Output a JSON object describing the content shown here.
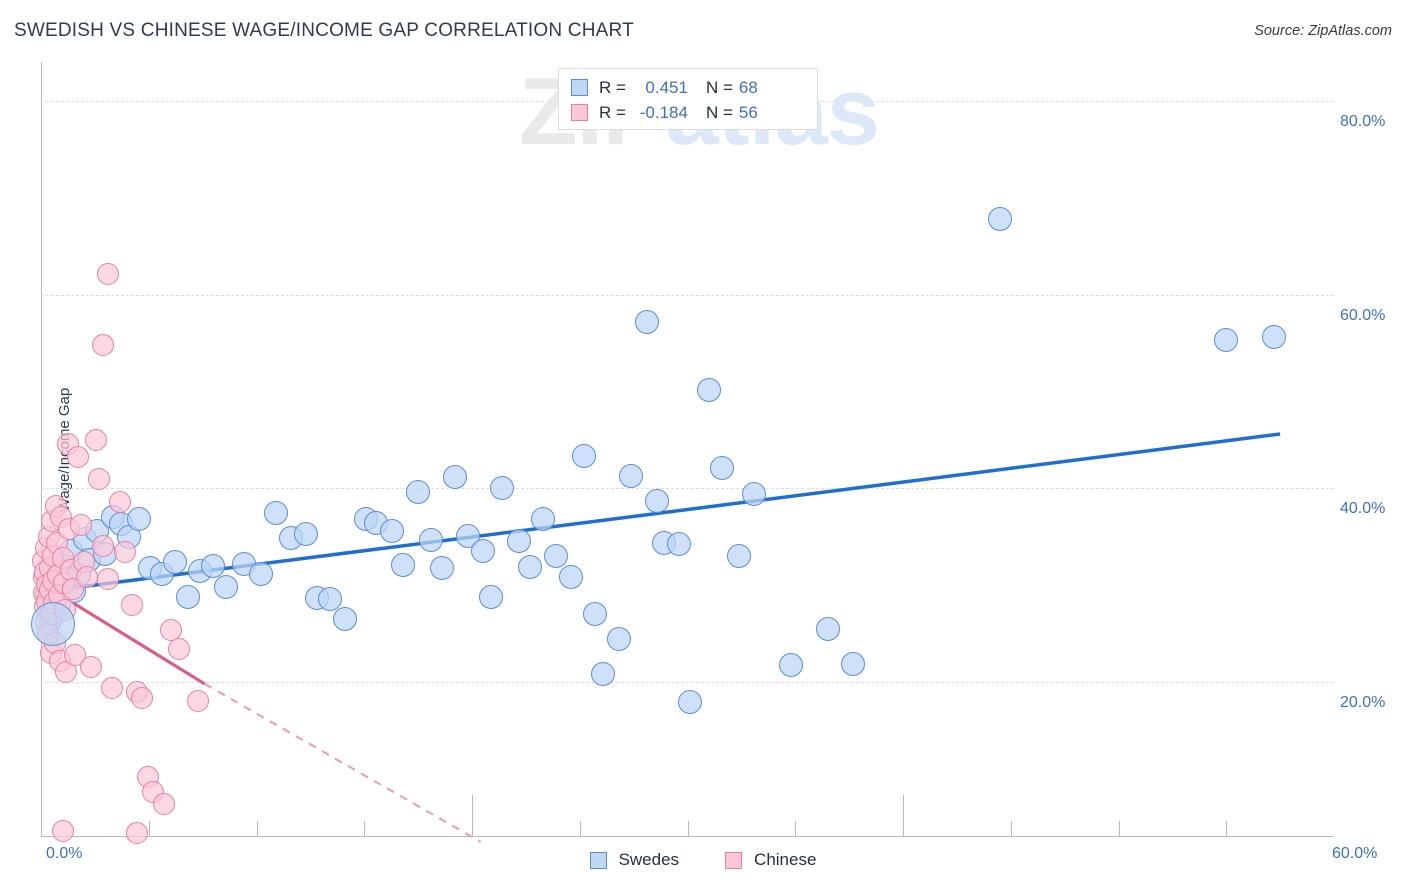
{
  "header": {
    "title": "SWEDISH VS CHINESE WAGE/INCOME GAP CORRELATION CHART",
    "source": "Source: ZipAtlas.com"
  },
  "watermark": {
    "part1": "ZIP",
    "part2": "atlas"
  },
  "stats": {
    "rows": [
      {
        "series": "Swedes",
        "r_label": "R =",
        "r_value": "0.451",
        "n_label": "N =",
        "n_value": "68",
        "color": "#bdd7f5"
      },
      {
        "series": "Chinese",
        "r_label": "R =",
        "r_value": "-0.184",
        "n_label": "N =",
        "n_value": "56",
        "color": "#fac7d7"
      }
    ]
  },
  "legend": {
    "items": [
      {
        "label": "Swedes",
        "color": "#bdd7f5",
        "border": "#5b8dd6"
      },
      {
        "label": "Chinese",
        "color": "#fac7d7",
        "border": "#e8819f"
      }
    ]
  },
  "chart_data": {
    "type": "scatter",
    "title": "SWEDISH VS CHINESE WAGE/INCOME GAP CORRELATION CHART",
    "xlabel": "",
    "ylabel": "Wage/Income Gap",
    "xlim": [
      0,
      60
    ],
    "ylim": [
      4.0,
      84.0
    ],
    "grid": true,
    "legend_position": "bottom",
    "x_tick_labels": [
      "0.0%",
      "60.0%"
    ],
    "x_ticks": [
      0,
      60
    ],
    "y_tick_labels": [
      "20.0%",
      "40.0%",
      "60.0%",
      "80.0%"
    ],
    "y_ticks": [
      20,
      40,
      60,
      80
    ],
    "series": [
      {
        "name": "Swedes",
        "color": "#bdd7f5",
        "border": "#5b8dd6",
        "r": 0.451,
        "n": 68,
        "trendline": {
          "style": "solid",
          "x0": 0.0,
          "y0": 29.3,
          "x1": 57.5,
          "y1": 45.6
        },
        "points": [
          [
            0.3,
            29.0
          ],
          [
            0.45,
            26.5
          ],
          [
            0.55,
            31.5
          ],
          [
            0.7,
            30.2
          ],
          [
            0.85,
            28.0
          ],
          [
            1.05,
            32.0
          ],
          [
            1.2,
            30.6
          ],
          [
            1.4,
            33.5
          ],
          [
            1.55,
            29.4
          ],
          [
            1.75,
            31.0
          ],
          [
            2.05,
            34.8
          ],
          [
            2.25,
            32.6
          ],
          [
            2.6,
            35.6
          ],
          [
            2.95,
            33.2
          ],
          [
            3.35,
            37.0
          ],
          [
            3.7,
            36.3
          ],
          [
            4.1,
            35.0
          ],
          [
            4.55,
            36.8
          ],
          [
            5.05,
            31.8
          ],
          [
            5.6,
            31.2
          ],
          [
            6.2,
            32.4
          ],
          [
            6.8,
            28.8
          ],
          [
            7.4,
            31.5
          ],
          [
            8.0,
            32.0
          ],
          [
            8.6,
            29.8
          ],
          [
            9.4,
            32.2
          ],
          [
            10.2,
            31.2
          ],
          [
            10.9,
            37.4
          ],
          [
            11.6,
            34.9
          ],
          [
            12.3,
            35.3
          ],
          [
            12.8,
            28.7
          ],
          [
            13.4,
            28.6
          ],
          [
            14.1,
            26.5
          ],
          [
            15.1,
            36.8
          ],
          [
            15.55,
            36.4
          ],
          [
            16.3,
            35.6
          ],
          [
            16.8,
            32.1
          ],
          [
            17.5,
            39.6
          ],
          [
            18.1,
            34.7
          ],
          [
            18.6,
            31.8
          ],
          [
            19.2,
            41.2
          ],
          [
            19.8,
            35.1
          ],
          [
            20.5,
            33.5
          ],
          [
            20.9,
            28.8
          ],
          [
            21.4,
            40.0
          ],
          [
            22.2,
            34.6
          ],
          [
            22.7,
            31.9
          ],
          [
            23.3,
            36.8
          ],
          [
            23.9,
            33.0
          ],
          [
            24.6,
            30.8
          ],
          [
            25.2,
            43.3
          ],
          [
            25.7,
            27.0
          ],
          [
            26.1,
            20.8
          ],
          [
            26.8,
            24.4
          ],
          [
            27.4,
            41.3
          ],
          [
            28.1,
            57.2
          ],
          [
            28.6,
            38.7
          ],
          [
            28.9,
            34.3
          ],
          [
            29.6,
            34.2
          ],
          [
            30.1,
            17.9
          ],
          [
            31.0,
            50.1
          ],
          [
            31.6,
            42.1
          ],
          [
            32.4,
            33.0
          ],
          [
            33.1,
            39.4
          ],
          [
            34.8,
            21.8
          ],
          [
            36.5,
            25.5
          ],
          [
            37.7,
            21.9
          ],
          [
            44.5,
            67.8
          ]
        ],
        "far_right_points": [
          [
            55.0,
            55.3
          ],
          [
            57.2,
            55.6
          ]
        ]
      },
      {
        "name": "Chinese",
        "color": "#fac7d7",
        "border": "#e8819f",
        "r": -0.184,
        "n": 56,
        "trendline": {
          "style": "solid-then-dashed",
          "x0": 0.0,
          "y0": 30.2,
          "x_solid_end": 7.6,
          "y_solid_end": 19.8,
          "x1": 20.4,
          "y1": 3.5
        },
        "points": [
          [
            0.1,
            32.5
          ],
          [
            0.12,
            30.8
          ],
          [
            0.15,
            29.2
          ],
          [
            0.18,
            27.8
          ],
          [
            0.2,
            31.4
          ],
          [
            0.22,
            26.2
          ],
          [
            0.25,
            33.8
          ],
          [
            0.28,
            30.0
          ],
          [
            0.3,
            28.4
          ],
          [
            0.33,
            25.0
          ],
          [
            0.36,
            35.0
          ],
          [
            0.4,
            31.8
          ],
          [
            0.42,
            29.5
          ],
          [
            0.45,
            27.0
          ],
          [
            0.48,
            23.0
          ],
          [
            0.52,
            36.6
          ],
          [
            0.55,
            33.0
          ],
          [
            0.58,
            30.4
          ],
          [
            0.62,
            28.2
          ],
          [
            0.66,
            24.0
          ],
          [
            0.7,
            38.2
          ],
          [
            0.75,
            34.4
          ],
          [
            0.8,
            31.0
          ],
          [
            0.85,
            29.0
          ],
          [
            0.9,
            22.2
          ],
          [
            0.95,
            37.0
          ],
          [
            1.0,
            32.8
          ],
          [
            1.05,
            30.2
          ],
          [
            1.1,
            27.4
          ],
          [
            1.15,
            21.0
          ],
          [
            1.25,
            44.6
          ],
          [
            1.3,
            35.8
          ],
          [
            1.4,
            31.6
          ],
          [
            1.5,
            29.6
          ],
          [
            1.6,
            22.8
          ],
          [
            1.7,
            43.2
          ],
          [
            1.85,
            36.2
          ],
          [
            2.0,
            32.4
          ],
          [
            2.15,
            30.8
          ],
          [
            2.3,
            21.6
          ],
          [
            2.55,
            45.0
          ],
          [
            2.7,
            41.0
          ],
          [
            2.9,
            34.0
          ],
          [
            3.1,
            30.6
          ],
          [
            3.3,
            19.4
          ],
          [
            3.65,
            38.6
          ],
          [
            3.9,
            33.4
          ],
          [
            4.2,
            28.0
          ],
          [
            4.45,
            19.0
          ],
          [
            4.7,
            18.4
          ],
          [
            4.95,
            10.2
          ],
          [
            5.2,
            8.6
          ],
          [
            3.1,
            62.1
          ],
          [
            2.9,
            54.8
          ],
          [
            5.7,
            7.4
          ],
          [
            6.4,
            23.4
          ]
        ],
        "extra_points": [
          [
            6.05,
            25.4
          ],
          [
            1.0,
            4.6
          ],
          [
            4.45,
            4.4
          ],
          [
            7.3,
            18.0
          ]
        ]
      }
    ]
  }
}
